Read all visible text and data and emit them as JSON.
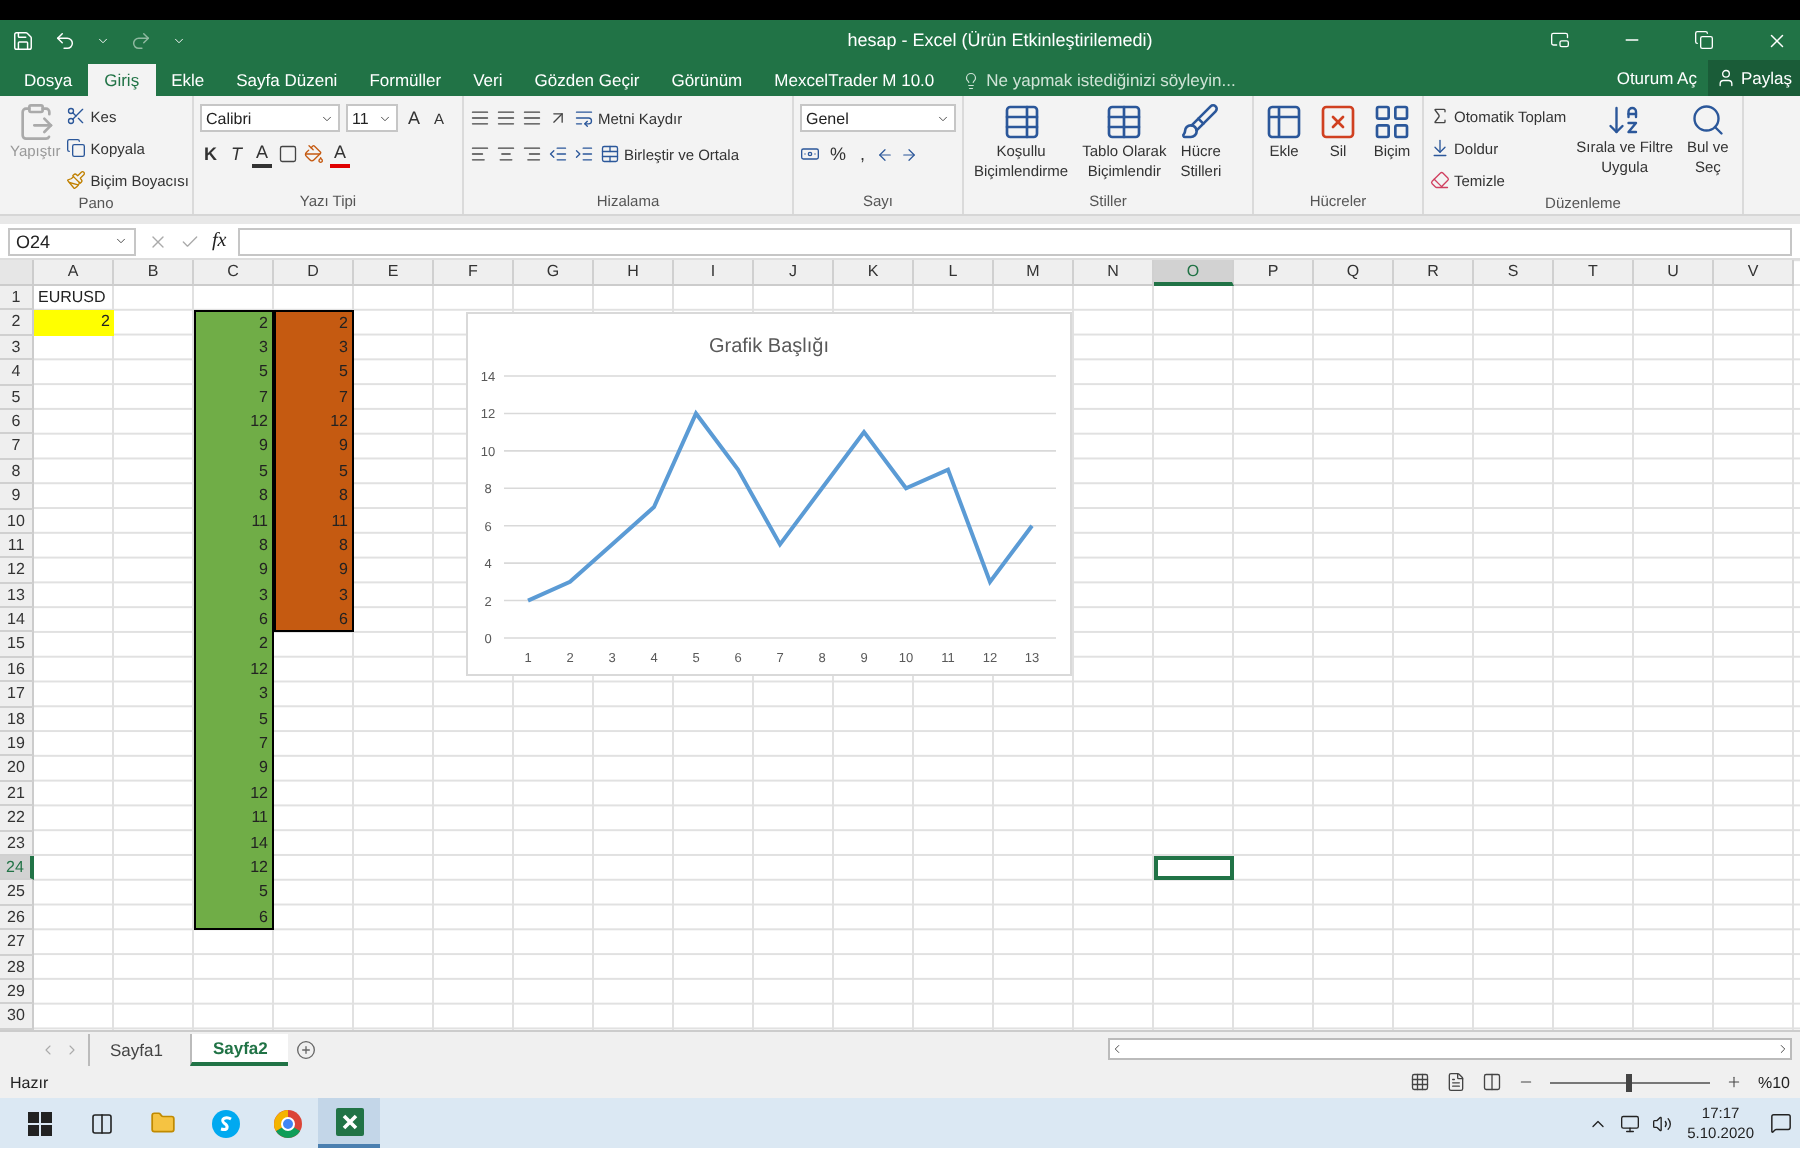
{
  "title_bar": {
    "title": "hesap - Excel (Ürün Etkinleştirilemedi)"
  },
  "menu_tabs": [
    {
      "label": "Dosya",
      "selected": false
    },
    {
      "label": "Giriş",
      "selected": true
    },
    {
      "label": "Ekle",
      "selected": false
    },
    {
      "label": "Sayfa Düzeni",
      "selected": false
    },
    {
      "label": "Formüller",
      "selected": false
    },
    {
      "label": "Veri",
      "selected": false
    },
    {
      "label": "Gözden Geçir",
      "selected": false
    },
    {
      "label": "Görünüm",
      "selected": false
    },
    {
      "label": "MexcelTrader M 10.0",
      "selected": false
    }
  ],
  "tell_me": {
    "placeholder": "Ne yapmak istediğinizi söyleyin..."
  },
  "account": {
    "sign_in": "Oturum Aç",
    "share": "Paylaş"
  },
  "ribbon": {
    "clipboard": {
      "label": "Pano",
      "paste": "Yapıştır",
      "cut": "Kes",
      "copy": "Kopyala",
      "format_painter": "Biçim Boyacısı"
    },
    "font": {
      "label": "Yazı Tipi",
      "font_name": "Calibri",
      "font_size": "11",
      "grow": "A",
      "shrink": "A",
      "bold": "K",
      "italic": "T",
      "underline": "A",
      "font_color": "A"
    },
    "alignment": {
      "label": "Hizalama",
      "wrap_text": "Metni Kaydır",
      "merge": "Birleştir ve Ortala"
    },
    "number": {
      "label": "Sayı",
      "format": "Genel",
      "percent": "%",
      "comma": ","
    },
    "styles": {
      "label": "Stiller",
      "buttons": [
        {
          "lines": [
            "Koşullu",
            "Biçimlendirme"
          ]
        },
        {
          "lines": [
            "Tablo Olarak",
            "Biçimlendir"
          ]
        },
        {
          "lines": [
            "Hücre",
            "Stilleri"
          ]
        }
      ]
    },
    "cells": {
      "label": "Hücreler",
      "buttons": [
        {
          "lines": [
            "Ekle"
          ]
        },
        {
          "lines": [
            "Sil"
          ]
        },
        {
          "lines": [
            "Biçim"
          ]
        }
      ]
    },
    "editing": {
      "label": "Düzenleme",
      "autosum": "Otomatik Toplam",
      "fill": "Doldur",
      "clear": "Temizle",
      "buttons": [
        {
          "lines": [
            "Sırala ve Filtre",
            "Uygula"
          ]
        },
        {
          "lines": [
            "Bul ve",
            "Seç"
          ]
        }
      ]
    }
  },
  "formula_bar": {
    "name_box": "O24",
    "function_label": "fx"
  },
  "sheet": {
    "columns": [
      {
        "label": "A",
        "selected": false
      },
      {
        "label": "B",
        "selected": false
      },
      {
        "label": "C",
        "selected": false
      },
      {
        "label": "D",
        "selected": false
      },
      {
        "label": "E",
        "selected": false
      },
      {
        "label": "F",
        "selected": false
      },
      {
        "label": "G",
        "selected": false
      },
      {
        "label": "H",
        "selected": false
      },
      {
        "label": "I",
        "selected": false
      },
      {
        "label": "J",
        "selected": false
      },
      {
        "label": "K",
        "selected": false
      },
      {
        "label": "L",
        "selected": false
      },
      {
        "label": "M",
        "selected": false
      },
      {
        "label": "N",
        "selected": false
      },
      {
        "label": "O",
        "selected": true
      },
      {
        "label": "P",
        "selected": false
      },
      {
        "label": "Q",
        "selected": false
      },
      {
        "label": "R",
        "selected": false
      },
      {
        "label": "S",
        "selected": false
      },
      {
        "label": "T",
        "selected": false
      },
      {
        "label": "U",
        "selected": false
      },
      {
        "label": "V",
        "selected": false
      }
    ],
    "rows": [
      {
        "label": "1",
        "selected": false,
        "column_a": {
          "value": "EURUSD"
        }
      },
      {
        "label": "2",
        "selected": false,
        "column_a": {
          "value": "2",
          "color": "#ffff00"
        },
        "column_c": {
          "value": "2",
          "color": "#70ad47"
        },
        "column_d": {
          "value": "2",
          "color": "#c55a11"
        }
      },
      {
        "label": "3",
        "selected": false,
        "column_c": {
          "value": "3",
          "color": "#70ad47"
        },
        "column_d": {
          "value": "3",
          "color": "#c55a11"
        }
      },
      {
        "label": "4",
        "selected": false,
        "column_c": {
          "value": "5",
          "color": "#70ad47"
        },
        "column_d": {
          "value": "5",
          "color": "#c55a11"
        }
      },
      {
        "label": "5",
        "selected": false,
        "column_c": {
          "value": "7",
          "color": "#70ad47"
        },
        "column_d": {
          "value": "7",
          "color": "#c55a11"
        }
      },
      {
        "label": "6",
        "selected": false,
        "column_c": {
          "value": "12",
          "color": "#70ad47"
        },
        "column_d": {
          "value": "12",
          "color": "#c55a11"
        }
      },
      {
        "label": "7",
        "selected": false,
        "column_c": {
          "value": "9",
          "color": "#70ad47"
        },
        "column_d": {
          "value": "9",
          "color": "#c55a11"
        }
      },
      {
        "label": "8",
        "selected": false,
        "column_c": {
          "value": "5",
          "color": "#70ad47"
        },
        "column_d": {
          "value": "5",
          "color": "#c55a11"
        }
      },
      {
        "label": "9",
        "selected": false,
        "column_c": {
          "value": "8",
          "color": "#70ad47"
        },
        "column_d": {
          "value": "8",
          "color": "#c55a11"
        }
      },
      {
        "label": "10",
        "selected": false,
        "column_c": {
          "value": "11",
          "color": "#70ad47"
        },
        "column_d": {
          "value": "11",
          "color": "#c55a11"
        }
      },
      {
        "label": "11",
        "selected": false,
        "column_c": {
          "value": "8",
          "color": "#70ad47"
        },
        "column_d": {
          "value": "8",
          "color": "#c55a11"
        }
      },
      {
        "label": "12",
        "selected": false,
        "column_c": {
          "value": "9",
          "color": "#70ad47"
        },
        "column_d": {
          "value": "9",
          "color": "#c55a11"
        }
      },
      {
        "label": "13",
        "selected": false,
        "column_c": {
          "value": "3",
          "color": "#70ad47"
        },
        "column_d": {
          "value": "3",
          "color": "#c55a11"
        }
      },
      {
        "label": "14",
        "selected": false,
        "column_c": {
          "value": "6",
          "color": "#70ad47"
        },
        "column_d": {
          "value": "6",
          "color": "#c55a11"
        }
      },
      {
        "label": "15",
        "selected": false,
        "column_c": {
          "value": "2",
          "color": "#70ad47"
        }
      },
      {
        "label": "16",
        "selected": false,
        "column_c": {
          "value": "12",
          "color": "#70ad47"
        }
      },
      {
        "label": "17",
        "selected": false,
        "column_c": {
          "value": "3",
          "color": "#70ad47"
        }
      },
      {
        "label": "18",
        "selected": false,
        "column_c": {
          "value": "5",
          "color": "#70ad47"
        }
      },
      {
        "label": "19",
        "selected": false,
        "column_c": {
          "value": "7",
          "color": "#70ad47"
        }
      },
      {
        "label": "20",
        "selected": false,
        "column_c": {
          "value": "9",
          "color": "#70ad47"
        }
      },
      {
        "label": "21",
        "selected": false,
        "column_c": {
          "value": "12",
          "color": "#70ad47"
        }
      },
      {
        "label": "22",
        "selected": false,
        "column_c": {
          "value": "11",
          "color": "#70ad47"
        }
      },
      {
        "label": "23",
        "selected": false,
        "column_c": {
          "value": "14",
          "color": "#70ad47"
        }
      },
      {
        "label": "24",
        "selected": true,
        "column_c": {
          "value": "12",
          "color": "#70ad47"
        }
      },
      {
        "label": "25",
        "selected": false,
        "column_c": {
          "value": "5",
          "color": "#70ad47"
        }
      },
      {
        "label": "26",
        "selected": false,
        "column_c": {
          "value": "6",
          "color": "#70ad47"
        }
      },
      {
        "label": "27",
        "selected": false
      },
      {
        "label": "28",
        "selected": false
      },
      {
        "label": "29",
        "selected": false
      },
      {
        "label": "30",
        "selected": false
      }
    ]
  },
  "chart": {
    "chart_data": {
      "type": "line",
      "title": "Grafik Başlığı",
      "grid": true,
      "categories": [
        "1",
        "2",
        "3",
        "4",
        "5",
        "6",
        "7",
        "8",
        "9",
        "10",
        "11",
        "12",
        "13"
      ],
      "series": [
        {
          "color": "#5b9bd5",
          "values": [
            2,
            3,
            5,
            7,
            12,
            9,
            5,
            8,
            11,
            8,
            9,
            3,
            6
          ]
        }
      ],
      "ylim": [
        0,
        14
      ],
      "yticks": [
        0,
        2,
        4,
        6,
        8,
        10,
        12,
        14
      ]
    }
  },
  "sheet_tabs": [
    {
      "label": "Sayfa1",
      "selected": false
    },
    {
      "label": "Sayfa2",
      "selected": true
    }
  ],
  "status_bar": {
    "status": "Hazır",
    "zoom": {
      "level": 0.5,
      "reading": "%10"
    }
  },
  "taskbar": {
    "time": "17:17",
    "date": "5.10.2020"
  }
}
